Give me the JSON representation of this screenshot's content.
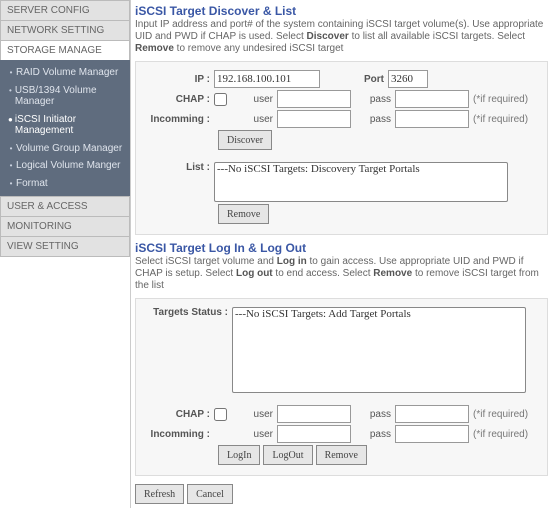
{
  "sidebar": {
    "server_config": "SERVER CONFIG",
    "network_setting": "NETWORK SETTING",
    "storage_manage": "STORAGE MANAGE",
    "sub": {
      "raid": "RAID Volume Manager",
      "usb": "USB/1394 Volume Manager",
      "iscsi_initiator": "iSCSI Initiator Management",
      "vg": "Volume Group Manager",
      "lv": "Logical Volume Manger",
      "format": "Format"
    },
    "user_access": "USER & ACCESS",
    "monitoring": "MONITORING",
    "view_setting": "VIEW SETTING"
  },
  "discover": {
    "title": "iSCSI Target Discover & List",
    "desc_pre": "Input IP address and port# of the system containing iSCSI target volume(s). Use appropriate UID and PWD if CHAP is used. Select ",
    "desc_b1": "Discover",
    "desc_mid": " to list all available iSCSI targets. Select ",
    "desc_b2": "Remove",
    "desc_post": " to remove any undesired iSCSI target",
    "labels": {
      "ip": "IP :",
      "port": "Port",
      "chap": "CHAP :",
      "user": "user",
      "pass": "pass",
      "incoming": "Incomming :",
      "list": "List :",
      "req": "(*if required)"
    },
    "values": {
      "ip": "192.168.100.101",
      "port": "3260",
      "chap_user": "",
      "chap_pass": "",
      "in_user": "",
      "in_pass": ""
    },
    "buttons": {
      "discover": "Discover",
      "remove": "Remove"
    },
    "list_option": "---No iSCSI Targets: Discovery Target Portals"
  },
  "login": {
    "title": "iSCSI Target Log In & Log Out",
    "desc_pre": "Select iSCSI target volume and ",
    "desc_b1": "Log in",
    "desc_mid1": " to gain access. Use appropriate UID and PWD if CHAP is setup. Select ",
    "desc_b2": "Log out",
    "desc_mid2": " to end access. Select ",
    "desc_b3": "Remove",
    "desc_post": " to remove iSCSI target from the list",
    "labels": {
      "targets_status": "Targets Status :",
      "chap": "CHAP :",
      "user": "user",
      "pass": "pass",
      "incoming": "Incomming :",
      "req": "(*if required)"
    },
    "values": {
      "chap_user": "",
      "chap_pass": "",
      "in_user": "",
      "in_pass": ""
    },
    "buttons": {
      "login": "LogIn",
      "logout": "LogOut",
      "remove": "Remove"
    },
    "targets_option": "---No iSCSI Targets: Add Target Portals"
  },
  "footer": {
    "refresh": "Refresh",
    "cancel": "Cancel"
  }
}
